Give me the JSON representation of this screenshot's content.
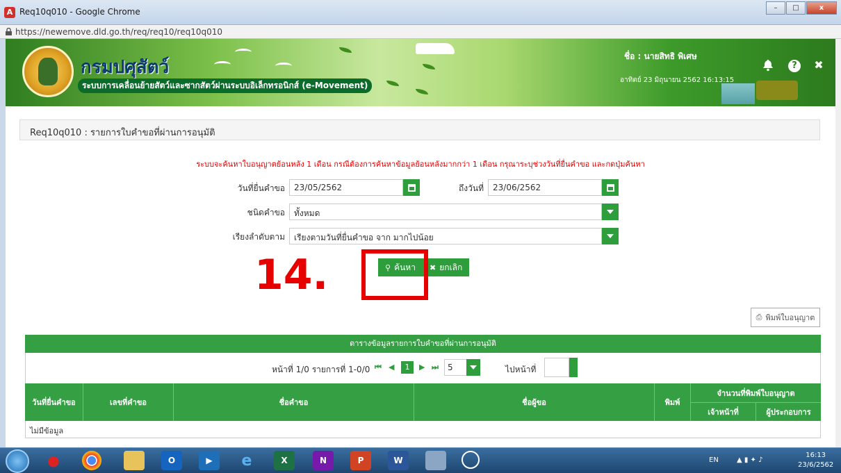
{
  "window": {
    "title": "Req10q010 - Google Chrome",
    "url": "https://newemove.dld.go.th/req/req10/req10q010",
    "minimize": "–",
    "maximize": "□",
    "close": "x"
  },
  "header": {
    "brand_title": "กรมปศุสัตว์",
    "brand_subtitle": "ระบบการเคลื่อนย้ายสัตว์และซากสัตว์ผ่านระบบอิเล็กทรอนิกส์ (e-Movement)",
    "user_label": "ชื่อ : นายสิทธิ พิเศษ",
    "datetime": "อาทิตย์ 23 มิถุนายน 2562 16:13:15",
    "bell_icon": "bell-icon",
    "help_icon": "?",
    "close_icon": "✖"
  },
  "page": {
    "heading": "Req10q010 : รายการใบคำขอที่ผ่านการอนุมัติ",
    "notice": "ระบบจะค้นหาใบอนุญาตย้อนหลัง 1 เดือน กรณีต้องการค้นหาข้อมูลย้อนหลังมากกว่า 1 เดือน กรุณาระบุช่วงวันที่ยื่นคำขอ และกดปุ่มค้นหา"
  },
  "form": {
    "date_from_label": "วันที่ยื่นคำขอ",
    "date_from_value": "23/05/2562",
    "date_to_label": "ถึงวันที่",
    "date_to_value": "23/06/2562",
    "type_label": "ชนิดคำขอ",
    "type_value": "ทั้งหมด",
    "sort_label": "เรียงลำดับตาม",
    "sort_value": "เรียงตามวันที่ยื่นคำขอ จาก มากไปน้อย",
    "search_button": "ค้นหา",
    "cancel_button": "ยกเลิก"
  },
  "annotation": {
    "step_number": "14."
  },
  "print_button": "พิมพ์ใบอนุญาต",
  "table": {
    "title": "ตารางข้อมูลรายการใบคำขอที่ผ่านการอนุมัติ",
    "pager_info": "หน้าที่ 1/0 รายการที่ 1-0/0",
    "current_page": "1",
    "page_size": "5",
    "goto_label": "ไปหน้าที่",
    "columns": {
      "submit_date": "วันที่ยื่นคำขอ",
      "request_no": "เลขที่คำขอ",
      "request_name": "ชื่อคำขอ",
      "applicant": "ชื่อผู้ขอ",
      "print": "พิมพ์",
      "print_count": "จำนวนที่พิมพ์ใบอนุญาต",
      "officer": "เจ้าหน้าที่",
      "operator": "ผู้ประกอบการ"
    },
    "empty_text": "ไม่มีข้อมูล"
  },
  "taskbar": {
    "lang": "EN",
    "time": "16:13",
    "date": "23/6/2562"
  },
  "colors": {
    "accent_green": "#2e9e3c",
    "notice_red": "#e00000",
    "annotation_red": "#e60000"
  }
}
